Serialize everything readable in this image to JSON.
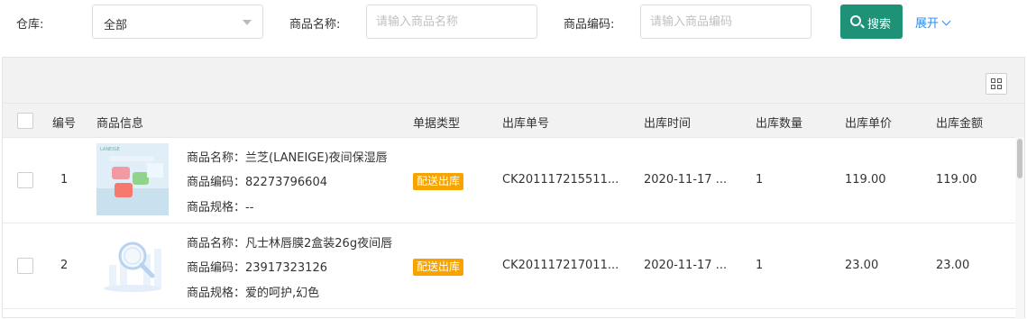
{
  "filters": {
    "warehouse_label": "仓库:",
    "warehouse_value": "全部",
    "name_label": "商品名称:",
    "name_placeholder": "请输入商品名称",
    "code_label": "商品编码:",
    "code_placeholder": "请输入商品编码",
    "search_label": "搜索",
    "expand_label": "展开"
  },
  "table": {
    "headers": {
      "no": "编号",
      "info": "商品信息",
      "doc_type": "单据类型",
      "out_no": "出库单号",
      "out_time": "出库时间",
      "qty": "出库数量",
      "price": "出库单价",
      "amount": "出库金额"
    },
    "rows": [
      {
        "no": "1",
        "name": "商品名称：兰芝(LANEIGE)夜间保湿唇",
        "code": "商品编码：82273796604",
        "spec": "商品规格：--",
        "doc_type": "配送出库",
        "out_no": "CK201117215511...",
        "out_time": "2020-11-17 ...",
        "qty": "1",
        "price": "119.00",
        "amount": "119.00",
        "image": "laneige-lip-mask-image"
      },
      {
        "no": "2",
        "name": "商品名称：凡士林唇膜2盒装26g夜间唇",
        "code": "商品编码：23917323126",
        "spec": "商品规格：爱的呵护,幻色",
        "doc_type": "配送出库",
        "out_no": "CK201117217011...",
        "out_time": "2020-11-17 ...",
        "qty": "1",
        "price": "23.00",
        "amount": "23.00",
        "image": "placeholder-search-image"
      }
    ]
  },
  "colors": {
    "search_button": "#1d9277",
    "tag": "#f7a400",
    "link": "#2d8cf0"
  }
}
